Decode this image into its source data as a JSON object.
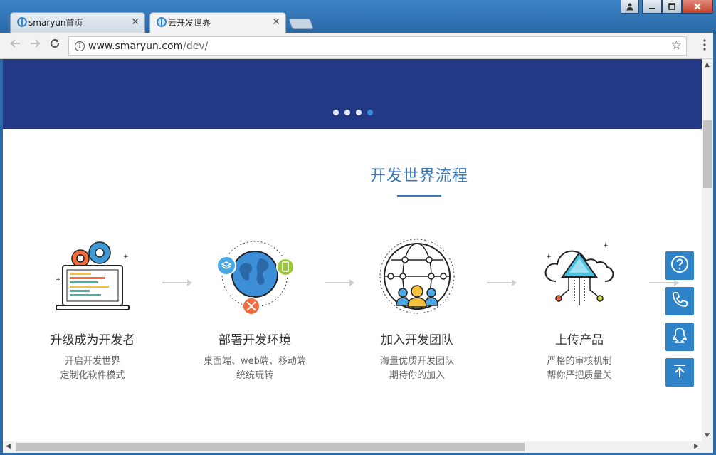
{
  "browser": {
    "tabs": [
      {
        "title": "smaryun首页",
        "active": false
      },
      {
        "title": "云开发世界",
        "active": true
      }
    ],
    "url_host": "www.smaryun.com",
    "url_path": "/dev/",
    "window_controls": {
      "user": "user-icon",
      "minimize": "minimize-icon",
      "maximize": "maximize-icon",
      "close": "close-icon"
    }
  },
  "banner": {
    "carousel_dots": 4,
    "active_dot": 4
  },
  "section": {
    "title": "开发世界流程"
  },
  "steps": [
    {
      "name": "升级成为开发者",
      "desc1": "开启开发世界",
      "desc2": "定制化软件模式",
      "icon": "laptop-gears-icon"
    },
    {
      "name": "部署开发环境",
      "desc1": "桌面端、web端、移动端",
      "desc2": "统统玩转",
      "icon": "globe-devices-icon"
    },
    {
      "name": "加入开发团队",
      "desc1": "海量优质开发团队",
      "desc2": "期待你的加入",
      "icon": "team-network-icon"
    },
    {
      "name": "上传产品",
      "desc1": "严格的审核机制",
      "desc2": "帮你严把质量关",
      "icon": "cloud-upload-icon"
    }
  ],
  "float_buttons": [
    "help-icon",
    "phone-icon",
    "qq-icon",
    "back-to-top-icon"
  ],
  "colors": {
    "banner": "#233985",
    "accent": "#3b78b8",
    "float": "#2f83c9",
    "active_dot": "#2c8fd9"
  }
}
